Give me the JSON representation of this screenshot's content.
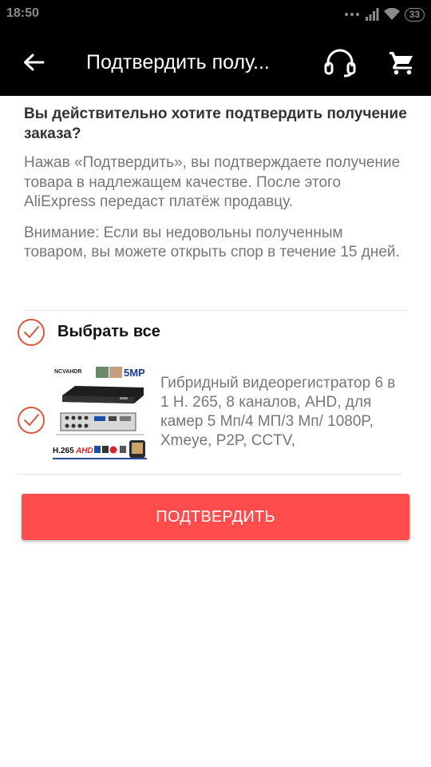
{
  "status_bar": {
    "time": "18:50",
    "battery": "33"
  },
  "app_bar": {
    "title": "Подтвердить полу..."
  },
  "content": {
    "question": "Вы действительно хотите подтвердить получение заказа?",
    "info": "Нажав «Подтвердить», вы подтверждаете получение товара в надлежащем качестве. После этого AliExpress передаст платёж продавцу.",
    "warning": "Внимание: Если вы недовольны полученным товаром, вы можете открыть спор в течение 15 дней."
  },
  "select_all": {
    "label": "Выбрать все",
    "checked": true
  },
  "product": {
    "title": "Гибридный видеорегистратор 6 в 1 H. 265, 8 каналов, AHD, для камер 5 Мп/4 МП/3 Мп/ 1080P, Xmeye, P2P, CCTV,",
    "checked": true,
    "image_texts": {
      "brand": "NCVAHDR",
      "resolution_badge": "5MP",
      "codec": "H.265",
      "ahd": "AHD"
    }
  },
  "confirm_button": {
    "label": "ПОДТВЕРДИТЬ"
  },
  "colors": {
    "accent": "#ff4c4c",
    "check": "#e0563e",
    "app_bar": "#000000"
  }
}
